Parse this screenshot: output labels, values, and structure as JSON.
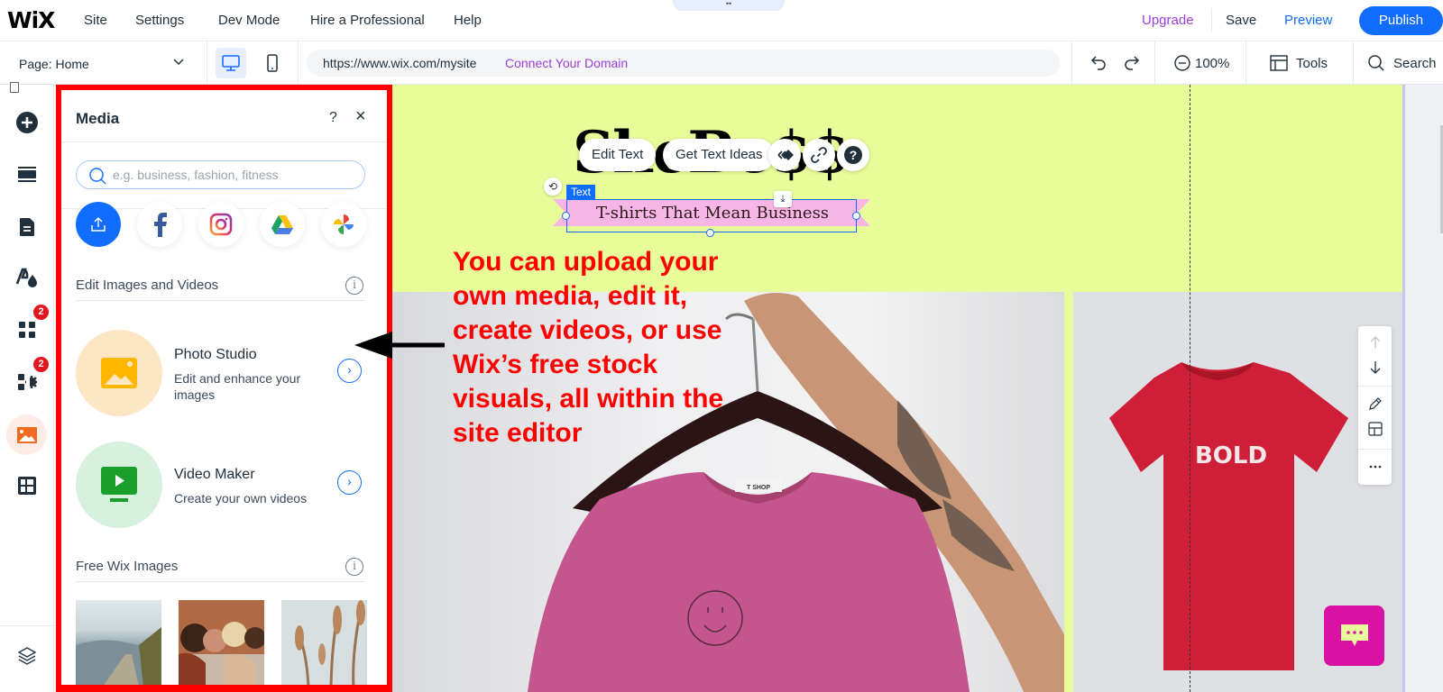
{
  "topbar": {
    "logo": "WiX",
    "menu": [
      "Site",
      "Settings",
      "Dev Mode",
      "Hire a Professional",
      "Help"
    ],
    "drag_handle": "••",
    "upgrade": "Upgrade",
    "save": "Save",
    "preview": "Preview",
    "publish": "Publish"
  },
  "subbar": {
    "page_label": "Page: Home",
    "url": "https://www.wix.com/mysite",
    "connect_domain": "Connect Your Domain",
    "zoom_level": "100%",
    "tools": "Tools",
    "search": "Search"
  },
  "rail": {
    "items": [
      {
        "name": "add-elements",
        "icon": "plus-circle-icon"
      },
      {
        "name": "sections",
        "icon": "sections-icon"
      },
      {
        "name": "pages",
        "icon": "page-icon"
      },
      {
        "name": "site-design",
        "icon": "theme-icon"
      },
      {
        "name": "apps",
        "icon": "apps-grid-icon",
        "badge": "2"
      },
      {
        "name": "business-apps",
        "icon": "apps-gear-icon",
        "badge": "2"
      },
      {
        "name": "media",
        "icon": "image-icon",
        "active": true
      },
      {
        "name": "cms",
        "icon": "table-icon"
      }
    ],
    "layers_icon": "layers-icon"
  },
  "media_panel": {
    "title": "Media",
    "help": "?",
    "close": "×",
    "search_placeholder": "e.g. business, fashion, fitness",
    "sources": [
      "upload",
      "facebook",
      "instagram",
      "google-drive",
      "google-photos"
    ],
    "edit_section_title": "Edit Images and Videos",
    "tools": [
      {
        "name": "Photo Studio",
        "desc": "Edit and enhance your images",
        "color": "#fde6c4",
        "icon_color": "#ffb700"
      },
      {
        "name": "Video Maker",
        "desc": "Create your own videos",
        "color": "#d6f1dd",
        "icon_color": "#1a9f2b"
      }
    ],
    "free_section_title": "Free Wix Images",
    "free_images": [
      "mountain-road",
      "group-of-women",
      "pampas-grass"
    ],
    "info": "i"
  },
  "canvas": {
    "brand_title": "SheBo$$",
    "edit_text": "Edit Text",
    "get_text_ideas": "Get Text Ideas",
    "text_tag": "Text",
    "tagline": "T-shirts That Mean Business",
    "shirt_label": "T SHOP",
    "shirt_text": "BOLD",
    "annotation": "You can upload your own media, edit it, create videos, or use Wix’s free stock visuals, all within the site editor",
    "colors": {
      "hero_bg": "#e8fc9a",
      "ribbon": "#f8b6e6",
      "annotation": "#ff0000",
      "chat": "#d911a4"
    }
  }
}
